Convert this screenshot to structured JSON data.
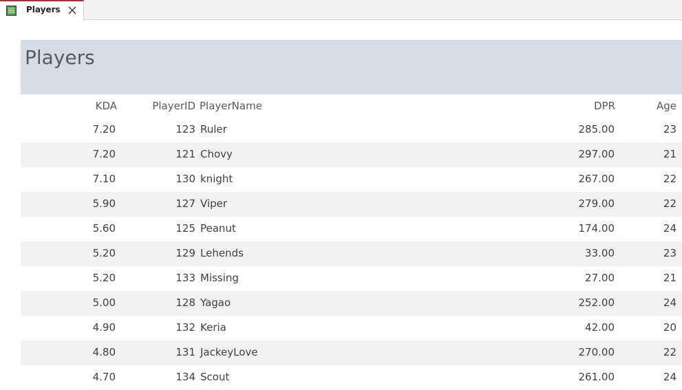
{
  "tab": {
    "label": "Players",
    "icon": "report-icon",
    "close_icon": "close-icon"
  },
  "report": {
    "title": "Players",
    "header_color": "#d6dce5"
  },
  "columns": {
    "kda": "KDA",
    "player_id": "PlayerID",
    "player_name": "PlayerName",
    "dpr": "DPR",
    "age": "Age"
  },
  "rows": [
    {
      "kda": "7.20",
      "player_id": "123",
      "player_name": "Ruler",
      "dpr": "285.00",
      "age": "23"
    },
    {
      "kda": "7.20",
      "player_id": "121",
      "player_name": "Chovy",
      "dpr": "297.00",
      "age": "21"
    },
    {
      "kda": "7.10",
      "player_id": "130",
      "player_name": "knight",
      "dpr": "267.00",
      "age": "22"
    },
    {
      "kda": "5.90",
      "player_id": "127",
      "player_name": "Viper",
      "dpr": "279.00",
      "age": "22"
    },
    {
      "kda": "5.60",
      "player_id": "125",
      "player_name": "Peanut",
      "dpr": "174.00",
      "age": "24"
    },
    {
      "kda": "5.20",
      "player_id": "129",
      "player_name": "Lehends",
      "dpr": "33.00",
      "age": "23"
    },
    {
      "kda": "5.20",
      "player_id": "133",
      "player_name": "Missing",
      "dpr": "27.00",
      "age": "21"
    },
    {
      "kda": "5.00",
      "player_id": "128",
      "player_name": "Yagao",
      "dpr": "252.00",
      "age": "24"
    },
    {
      "kda": "4.90",
      "player_id": "132",
      "player_name": "Keria",
      "dpr": "42.00",
      "age": "20"
    },
    {
      "kda": "4.80",
      "player_id": "131",
      "player_name": "JackeyLove",
      "dpr": "270.00",
      "age": "22"
    },
    {
      "kda": "4.70",
      "player_id": "134",
      "player_name": "Scout",
      "dpr": "261.00",
      "age": "24"
    }
  ]
}
